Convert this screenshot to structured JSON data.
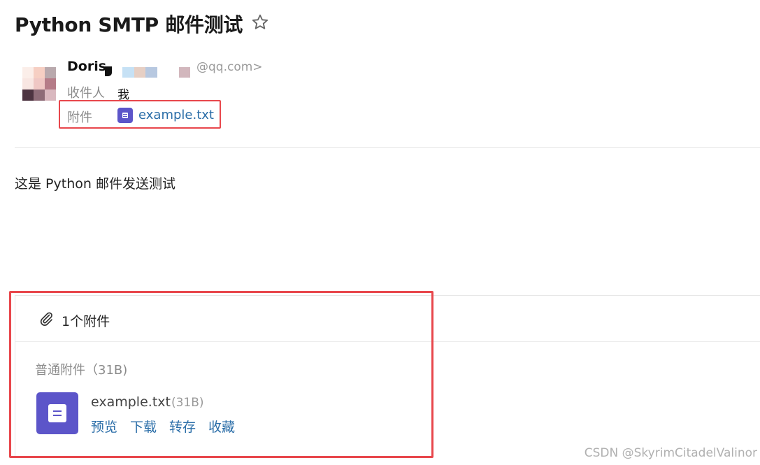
{
  "email": {
    "subject": "Python SMTP 邮件测试",
    "star_icon": "star-outline-icon",
    "sender": {
      "name": "Doris",
      "email_suffix": "@qq.com>",
      "avatar_colors": [
        "#fbeee9",
        "#f6cfc3",
        "#b9a9ad",
        "#f8e6e2",
        "#efc7c4",
        "#b57c88",
        "#4d3441",
        "#8e6c78",
        "#d9b8bf"
      ],
      "redaction_colors": [
        "#c6e1f5",
        "#e6cfc4",
        "#b7c8e0"
      ]
    },
    "recipient": {
      "label": "收件人",
      "value": "我"
    },
    "attachment_line": {
      "label": "附件",
      "file_name": "example.txt",
      "icon": "file-icon"
    },
    "body": "这是 Python 邮件发送测试"
  },
  "attachments_panel": {
    "icon": "paperclip-icon",
    "title": "1个附件",
    "section_label": "普通附件（31B)",
    "file": {
      "name": "example.txt",
      "size": "(31B)",
      "icon": "file-icon",
      "actions": [
        "预览",
        "下载",
        "转存",
        "收藏"
      ]
    }
  },
  "colors": {
    "accent_purple": "#5c55c9",
    "link_blue": "#2b6ea8",
    "highlight_red": "#e8474c"
  },
  "watermark": "CSDN @SkyrimCitadelValinor"
}
